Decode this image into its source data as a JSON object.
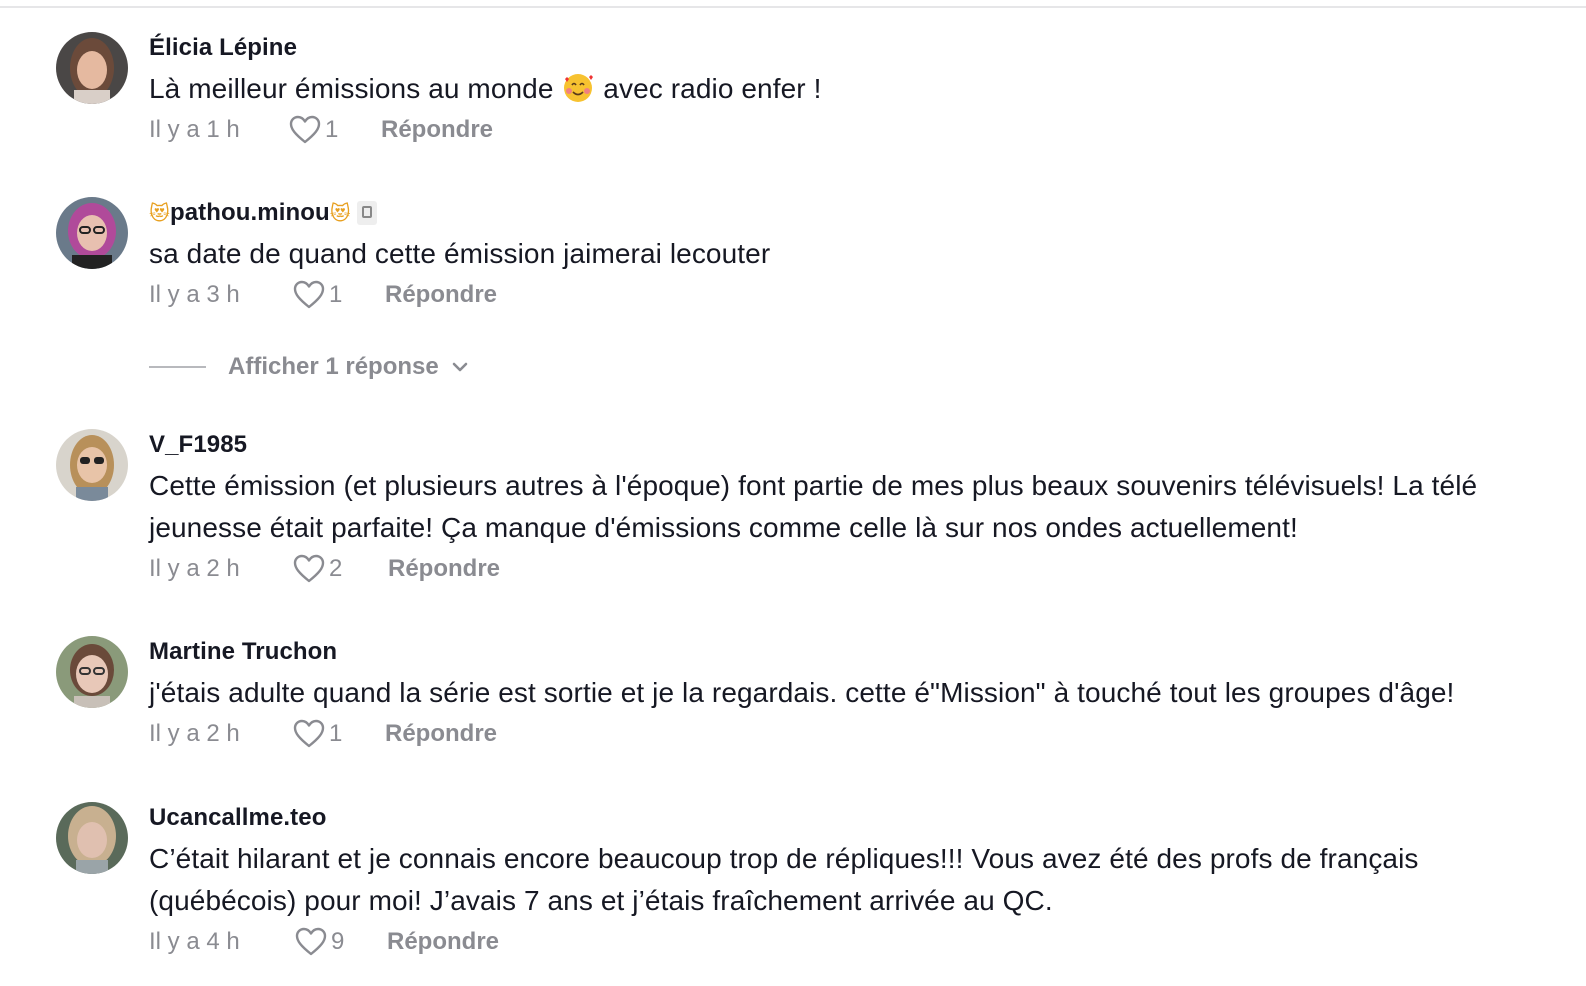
{
  "comments": [
    {
      "username": "Élicia Lépine",
      "text_before": "Là meilleur émissions au monde",
      "text_emoji": "smiling-face-with-hearts-emoji",
      "text_after": " avec radio enfer !",
      "timestamp": "Il y a 1 h",
      "likes": "1",
      "reply_label": "Répondre"
    },
    {
      "username": "pathou.minou",
      "username_prefix_emoji": "😻",
      "username_suffix_emoji": "😻",
      "username_badge": "badge-icon",
      "text": "sa date de quand cette émission jaimerai lecouter",
      "timestamp": "Il y a 3 h",
      "likes": "1",
      "reply_label": "Répondre",
      "view_replies_label": "Afficher 1 réponse"
    },
    {
      "username": "V_F1985",
      "text": "Cette émission (et plusieurs autres à l'époque) font partie de mes plus beaux souvenirs télévisuels! La télé jeunesse était parfaite! Ça manque d'émissions comme celle là sur nos ondes actuellement!",
      "timestamp": "Il y a 2 h",
      "likes": "2",
      "reply_label": "Répondre"
    },
    {
      "username": "Martine Truchon",
      "text": "j'étais adulte quand la série est sortie et je la regardais. cette é\"Mission\" à touché tout les groupes d'âge!",
      "timestamp": "Il y a 2 h",
      "likes": "1",
      "reply_label": "Répondre"
    },
    {
      "username": "Ucancallme.teo",
      "text": "C’était hilarant et je connais encore beaucoup trop de répliques!!! Vous avez été des profs de français (québécois) pour moi! J’avais 7 ans et j’étais fraîchement arrivée au QC.",
      "timestamp": "Il y a 4 h",
      "likes": "9",
      "reply_label": "Répondre"
    }
  ],
  "icons": {
    "like": "heart-outline-icon",
    "expand": "chevron-down-icon"
  },
  "colors": {
    "primary_text": "#161823",
    "secondary_text": "#8a8b91"
  }
}
